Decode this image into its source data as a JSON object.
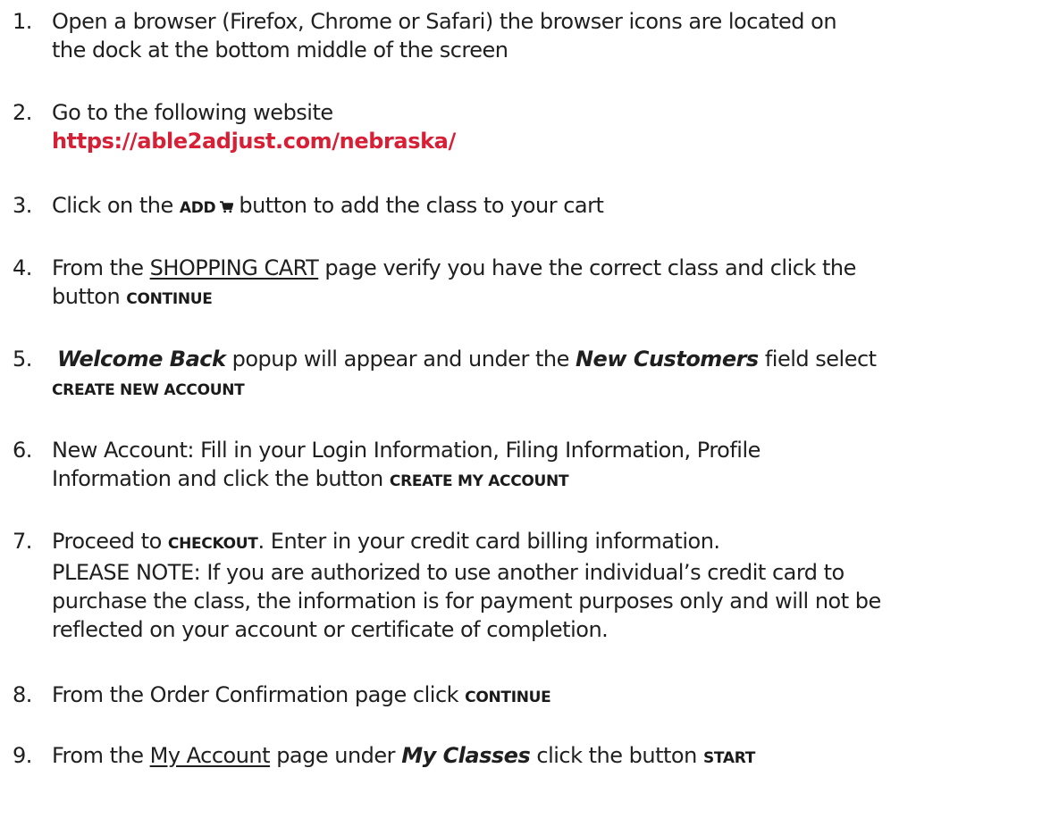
{
  "steps": [
    {
      "number": "1.",
      "line1": "Open a browser (Firefox, Chrome or Safari) the browser icons are located on",
      "line2": "the dock at the bottom middle of the screen"
    },
    {
      "number": "2.",
      "line1": "Go to the following website",
      "link": "https://able2adjust.com/nebraska/"
    },
    {
      "number": "3.",
      "prefix": "Click on the ",
      "button": "ADD",
      "suffix": "button to add the class to your cart"
    },
    {
      "number": "4.",
      "prefix": "From the ",
      "page_name": "SHOPPING CART",
      "suffix": " page verify you have the correct class and click the",
      "line2_prefix": "button ",
      "button": "CONTINUE"
    },
    {
      "number": "5.",
      "popup_name": "Welcome Back",
      "middle": " popup will appear and under the ",
      "field_name": "New Customers",
      "suffix": " field select",
      "button": "CREATE NEW ACCOUNT"
    },
    {
      "number": "6.",
      "line1": "New Account: Fill in your Login Information, Filing Information, Profile",
      "line2_prefix": "Information and click the button ",
      "button": "CREATE MY ACCOUNT"
    },
    {
      "number": "7.",
      "prefix": "Proceed to ",
      "button": "CHECKOUT",
      "suffix": ". Enter in your credit card billing information.",
      "line2": "PLEASE NOTE: If you are authorized to use another individual’s credit card to",
      "line3": "purchase the class, the information is for payment purposes only and will not be",
      "line4": "reflected on your account or certificate of completion."
    },
    {
      "number": "8.",
      "prefix": "From the Order Confirmation page click ",
      "button": "CONTINUE"
    },
    {
      "number": "9.",
      "prefix": "From the ",
      "page_name": "My Account",
      "middle": " page under ",
      "section_name": "My Classes",
      "suffix": " click the button ",
      "button": "START"
    }
  ],
  "colors": {
    "link": "#d71f36",
    "text": "#1f1f1f"
  },
  "icons": {
    "cart": "shopping-cart-icon"
  }
}
